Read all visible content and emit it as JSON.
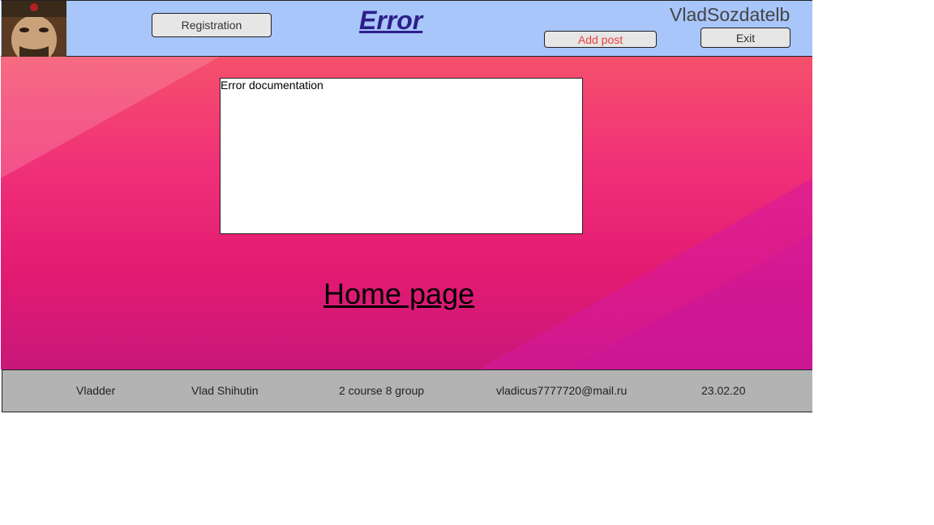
{
  "header": {
    "title": "Error",
    "username": "VladSozdatelb",
    "registration_label": "Registration",
    "add_post_label": "Add post",
    "exit_label": "Exit"
  },
  "main": {
    "doc_text": "Error documentation",
    "home_link": "Home page"
  },
  "footer": {
    "items": [
      "Vladder",
      "Vlad Shihutin",
      "2 course 8 group",
      "vladicus7777720@mail.ru",
      "23.02.20"
    ]
  },
  "colors": {
    "header_bg": "#a8c6fa",
    "title": "#2d1e8a",
    "add_post_text": "#e8413a",
    "footer_bg": "#b3b3b3"
  }
}
